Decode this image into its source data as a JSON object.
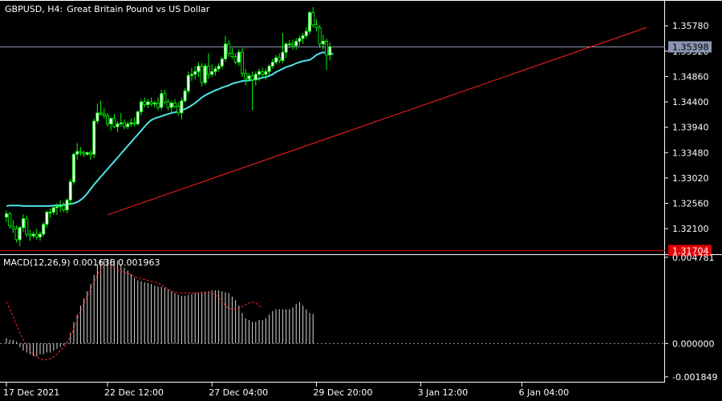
{
  "header": {
    "symbol": "GBPUSD, H4:",
    "description": "Great Britain Pound vs US Dollar"
  },
  "colors": {
    "background": "#000000",
    "grid": "#ffffff",
    "text": "#ffffff",
    "bull_candle": "#ffffff",
    "bear_candle": "#000000",
    "candle_outline": "#00ff00",
    "moving_average": "#4fe3e8",
    "trendline": "#ff2020",
    "current_price_line": "#8a96b4",
    "current_price_badge": "#8a96b4",
    "lower_label_badge": "#e00000",
    "macd_hist": "#d8d8d8",
    "macd_signal": "#ff2020"
  },
  "chart_data": [
    {
      "type": "candlestick",
      "id": "price",
      "ylim": [
        1.3168,
        1.3619
      ],
      "yticks": [
        "1.35780",
        "1.35320",
        "1.34860",
        "1.34400",
        "1.33940",
        "1.33480",
        "1.33020",
        "1.32560",
        "1.32100"
      ],
      "current_price_label": "1.35398",
      "lower_price_label": "1.31704",
      "candles": [
        [
          1.3231,
          1.3243,
          1.3222,
          1.3237
        ],
        [
          1.3237,
          1.324,
          1.321,
          1.3215
        ],
        [
          1.3214,
          1.3226,
          1.3202,
          1.321
        ],
        [
          1.321,
          1.3216,
          1.3185,
          1.319
        ],
        [
          1.319,
          1.3215,
          1.3178,
          1.3212
        ],
        [
          1.3212,
          1.3236,
          1.3204,
          1.3228
        ],
        [
          1.3228,
          1.3234,
          1.3195,
          1.32
        ],
        [
          1.32,
          1.3208,
          1.3188,
          1.3197
        ],
        [
          1.3197,
          1.3205,
          1.3193,
          1.32
        ],
        [
          1.32,
          1.321,
          1.319,
          1.3195
        ],
        [
          1.3195,
          1.3205,
          1.3188,
          1.32
        ],
        [
          1.32,
          1.3222,
          1.3196,
          1.3218
        ],
        [
          1.3218,
          1.3243,
          1.3212,
          1.324
        ],
        [
          1.324,
          1.3247,
          1.323,
          1.324
        ],
        [
          1.324,
          1.3252,
          1.3235,
          1.3248
        ],
        [
          1.3248,
          1.3256,
          1.3235,
          1.325
        ],
        [
          1.325,
          1.3262,
          1.324,
          1.3252
        ],
        [
          1.3252,
          1.3258,
          1.324,
          1.3244
        ],
        [
          1.3244,
          1.3265,
          1.3238,
          1.3262
        ],
        [
          1.3262,
          1.33,
          1.3255,
          1.3295
        ],
        [
          1.3295,
          1.3348,
          1.329,
          1.3345
        ],
        [
          1.3345,
          1.3365,
          1.3335,
          1.335
        ],
        [
          1.335,
          1.3358,
          1.3342,
          1.3348
        ],
        [
          1.3348,
          1.3352,
          1.334,
          1.3345
        ],
        [
          1.3345,
          1.335,
          1.3342,
          1.3348
        ],
        [
          1.3348,
          1.3352,
          1.3335,
          1.3345
        ],
        [
          1.3345,
          1.341,
          1.3338,
          1.3405
        ],
        [
          1.3405,
          1.3437,
          1.34,
          1.342
        ],
        [
          1.342,
          1.3442,
          1.3415,
          1.3418
        ],
        [
          1.3418,
          1.3428,
          1.341,
          1.3415
        ],
        [
          1.3415,
          1.342,
          1.3395,
          1.34
        ],
        [
          1.34,
          1.3412,
          1.3388,
          1.341
        ],
        [
          1.341,
          1.3418,
          1.3392,
          1.3395
        ],
        [
          1.3395,
          1.3405,
          1.3385,
          1.34
        ],
        [
          1.34,
          1.342,
          1.3395,
          1.3402
        ],
        [
          1.3402,
          1.3408,
          1.339,
          1.3395
        ],
        [
          1.3395,
          1.3405,
          1.339,
          1.34
        ],
        [
          1.34,
          1.341,
          1.3395,
          1.3402
        ],
        [
          1.3402,
          1.3412,
          1.3395,
          1.34
        ],
        [
          1.34,
          1.3425,
          1.3397,
          1.3422
        ],
        [
          1.3422,
          1.3445,
          1.3415,
          1.344
        ],
        [
          1.344,
          1.3448,
          1.343,
          1.3435
        ],
        [
          1.3435,
          1.3445,
          1.3428,
          1.344
        ],
        [
          1.344,
          1.3448,
          1.3432,
          1.3436
        ],
        [
          1.3436,
          1.3442,
          1.343,
          1.3438
        ],
        [
          1.3438,
          1.3448,
          1.3425,
          1.343
        ],
        [
          1.343,
          1.3462,
          1.3425,
          1.3455
        ],
        [
          1.3455,
          1.3462,
          1.3435,
          1.344
        ],
        [
          1.344,
          1.3445,
          1.3425,
          1.343
        ],
        [
          1.343,
          1.3442,
          1.342,
          1.3438
        ],
        [
          1.3438,
          1.3445,
          1.3428,
          1.3432
        ],
        [
          1.3432,
          1.344,
          1.3415,
          1.342
        ],
        [
          1.342,
          1.3448,
          1.3408,
          1.3442
        ],
        [
          1.3442,
          1.3465,
          1.3438,
          1.346
        ],
        [
          1.346,
          1.3495,
          1.3455,
          1.3488
        ],
        [
          1.3488,
          1.3502,
          1.3478,
          1.349
        ],
        [
          1.349,
          1.3505,
          1.348,
          1.3495
        ],
        [
          1.3495,
          1.3512,
          1.3485,
          1.3505
        ],
        [
          1.3505,
          1.351,
          1.3468,
          1.3475
        ],
        [
          1.3475,
          1.351,
          1.347,
          1.3505
        ],
        [
          1.3505,
          1.3528,
          1.3482,
          1.349
        ],
        [
          1.349,
          1.3508,
          1.3485,
          1.3495
        ],
        [
          1.3495,
          1.3505,
          1.3488,
          1.35
        ],
        [
          1.35,
          1.351,
          1.3495,
          1.3505
        ],
        [
          1.3505,
          1.3522,
          1.35,
          1.3518
        ],
        [
          1.3518,
          1.356,
          1.3512,
          1.3545
        ],
        [
          1.3545,
          1.3552,
          1.3522,
          1.3528
        ],
        [
          1.3528,
          1.3538,
          1.3518,
          1.3522
        ],
        [
          1.3522,
          1.3528,
          1.3508,
          1.3512
        ],
        [
          1.3512,
          1.3535,
          1.3505,
          1.353
        ],
        [
          1.353,
          1.3538,
          1.3485,
          1.3492
        ],
        [
          1.3492,
          1.35,
          1.347,
          1.3482
        ],
        [
          1.3482,
          1.3492,
          1.3476,
          1.3487
        ],
        [
          1.3487,
          1.3495,
          1.3425,
          1.348
        ],
        [
          1.348,
          1.3495,
          1.347,
          1.349
        ],
        [
          1.349,
          1.35,
          1.3478,
          1.3495
        ],
        [
          1.3495,
          1.3502,
          1.3485,
          1.349
        ],
        [
          1.349,
          1.35,
          1.348,
          1.3495
        ],
        [
          1.3495,
          1.3508,
          1.3488,
          1.3505
        ],
        [
          1.3505,
          1.3518,
          1.35,
          1.3512
        ],
        [
          1.3512,
          1.3525,
          1.3508,
          1.352
        ],
        [
          1.352,
          1.3528,
          1.351,
          1.3515
        ],
        [
          1.3515,
          1.3565,
          1.351,
          1.353
        ],
        [
          1.353,
          1.3548,
          1.352,
          1.3545
        ],
        [
          1.3545,
          1.3552,
          1.3538,
          1.3545
        ],
        [
          1.3545,
          1.3553,
          1.3535,
          1.3542
        ],
        [
          1.3542,
          1.3556,
          1.3535,
          1.355
        ],
        [
          1.355,
          1.356,
          1.3542,
          1.3555
        ],
        [
          1.3555,
          1.3565,
          1.3545,
          1.356
        ],
        [
          1.356,
          1.3575,
          1.3555,
          1.3568
        ],
        [
          1.3568,
          1.3605,
          1.3562,
          1.3602
        ],
        [
          1.3602,
          1.3612,
          1.3575,
          1.358
        ],
        [
          1.358,
          1.359,
          1.3568,
          1.3575
        ],
        [
          1.3575,
          1.358,
          1.3538,
          1.3545
        ],
        [
          1.3545,
          1.3562,
          1.3535,
          1.355
        ],
        [
          1.355,
          1.3555,
          1.3498,
          1.3525
        ],
        [
          1.3525,
          1.3548,
          1.3515,
          1.354
        ]
      ],
      "moving_average": [
        1.3251,
        1.3252,
        1.3252,
        1.3252,
        1.3252,
        1.3251,
        1.3251,
        1.3251,
        1.3251,
        1.3251,
        1.3251,
        1.3251,
        1.3251,
        1.3251,
        1.3252,
        1.3252,
        1.3253,
        1.3253,
        1.3254,
        1.3255,
        1.3256,
        1.3258,
        1.3262,
        1.3267,
        1.3274,
        1.3282,
        1.329,
        1.3297,
        1.3304,
        1.3311,
        1.3318,
        1.3325,
        1.3332,
        1.3339,
        1.3346,
        1.3353,
        1.336,
        1.3367,
        1.3374,
        1.3381,
        1.3388,
        1.3395,
        1.3402,
        1.3407,
        1.341,
        1.3412,
        1.3414,
        1.3416,
        1.3418,
        1.342,
        1.3421,
        1.3423,
        1.3425,
        1.3427,
        1.343,
        1.3434,
        1.3438,
        1.3443,
        1.3448,
        1.3452,
        1.3455,
        1.3458,
        1.3461,
        1.3463,
        1.3466,
        1.3468,
        1.347,
        1.3473,
        1.3475,
        1.3476,
        1.3478,
        1.3478,
        1.3479,
        1.348,
        1.3481,
        1.3482,
        1.3484,
        1.3485,
        1.3487,
        1.349,
        1.3494,
        1.3497,
        1.35,
        1.3503,
        1.3505,
        1.3507,
        1.351,
        1.3512,
        1.3514,
        1.3515,
        1.3516,
        1.352,
        1.3525,
        1.3528,
        1.353,
        1.3528,
        1.3527,
        1.3527
      ],
      "trendline": {
        "x": [
          30,
          190
        ],
        "y": [
          1.3235,
          1.3575
        ]
      }
    },
    {
      "type": "bar",
      "id": "macd",
      "title": "MACD(12,26,9) 0.001636 0.001963",
      "ylim": [
        -0.00212,
        0.00486
      ],
      "yticks": [
        "0.004781",
        "0.000000",
        "-0.001849"
      ],
      "histogram": [
        0.0003,
        0.0002,
        0.0002,
        0.0001,
        -0.0002,
        -0.0004,
        -0.0005,
        -0.0006,
        -0.0007,
        -0.0007,
        -0.0006,
        -0.0006,
        -0.0005,
        -0.0005,
        -0.0004,
        -0.0003,
        -0.0002,
        -0.0001,
        0.0001,
        0.0006,
        0.0012,
        0.0016,
        0.0021,
        0.0025,
        0.0029,
        0.0033,
        0.0038,
        0.0044,
        0.00465,
        0.0047,
        0.0047,
        0.0047,
        0.00465,
        0.0046,
        0.0044,
        0.0042,
        0.00405,
        0.00385,
        0.00365,
        0.0035,
        0.00345,
        0.0034,
        0.00335,
        0.0033,
        0.0032,
        0.00315,
        0.00315,
        0.0031,
        0.003,
        0.0029,
        0.0028,
        0.0027,
        0.00265,
        0.00265,
        0.0027,
        0.00275,
        0.0028,
        0.0028,
        0.0028,
        0.00285,
        0.0029,
        0.00295,
        0.00295,
        0.00295,
        0.0029,
        0.00285,
        0.0028,
        0.0026,
        0.0024,
        0.0021,
        0.0017,
        0.0014,
        0.0013,
        0.0012,
        0.0012,
        0.0013,
        0.0013,
        0.0014,
        0.0016,
        0.0018,
        0.0019,
        0.0019,
        0.0019,
        0.0019,
        0.0019,
        0.002,
        0.0022,
        0.0023,
        0.0021,
        0.0019,
        0.0017,
        0.00164
      ],
      "signal": [
        0.0023,
        0.0019,
        0.0015,
        0.001,
        0.0006,
        0.0002,
        -0.0001,
        -0.0004,
        -0.0006,
        -0.00075,
        -0.00085,
        -0.0009,
        -0.0009,
        -0.00085,
        -0.00075,
        -0.0006,
        -0.0004,
        -0.0002,
        5e-05,
        0.0004,
        0.0008,
        0.0013,
        0.0018,
        0.0022,
        0.0026,
        0.003,
        0.0034,
        0.0038,
        0.0041,
        0.0043,
        0.00435,
        0.0043,
        0.0042,
        0.0041,
        0.004,
        0.00395,
        0.0039,
        0.0038,
        0.0037,
        0.00365,
        0.0036,
        0.00355,
        0.0035,
        0.00345,
        0.0034,
        0.00335,
        0.00325,
        0.00315,
        0.003,
        0.0029,
        0.00285,
        0.0028,
        0.0028,
        0.0028,
        0.0028,
        0.0028,
        0.0028,
        0.00282,
        0.00285,
        0.00285,
        0.00285,
        0.0028,
        0.0027,
        0.00255,
        0.00235,
        0.0021,
        0.00195,
        0.0019,
        0.0019,
        0.00195,
        0.00205,
        0.00215,
        0.00225,
        0.0023,
        0.00225,
        0.0021,
        0.00196
      ]
    }
  ],
  "x_axis": {
    "labels": [
      "17 Dec 2021",
      "22 Dec 12:00",
      "27 Dec 04:00",
      "29 Dec 20:00",
      "3 Jan 12:00",
      "6 Jan 04:00"
    ],
    "label_bars": [
      0,
      30,
      61,
      92,
      123,
      153
    ]
  }
}
